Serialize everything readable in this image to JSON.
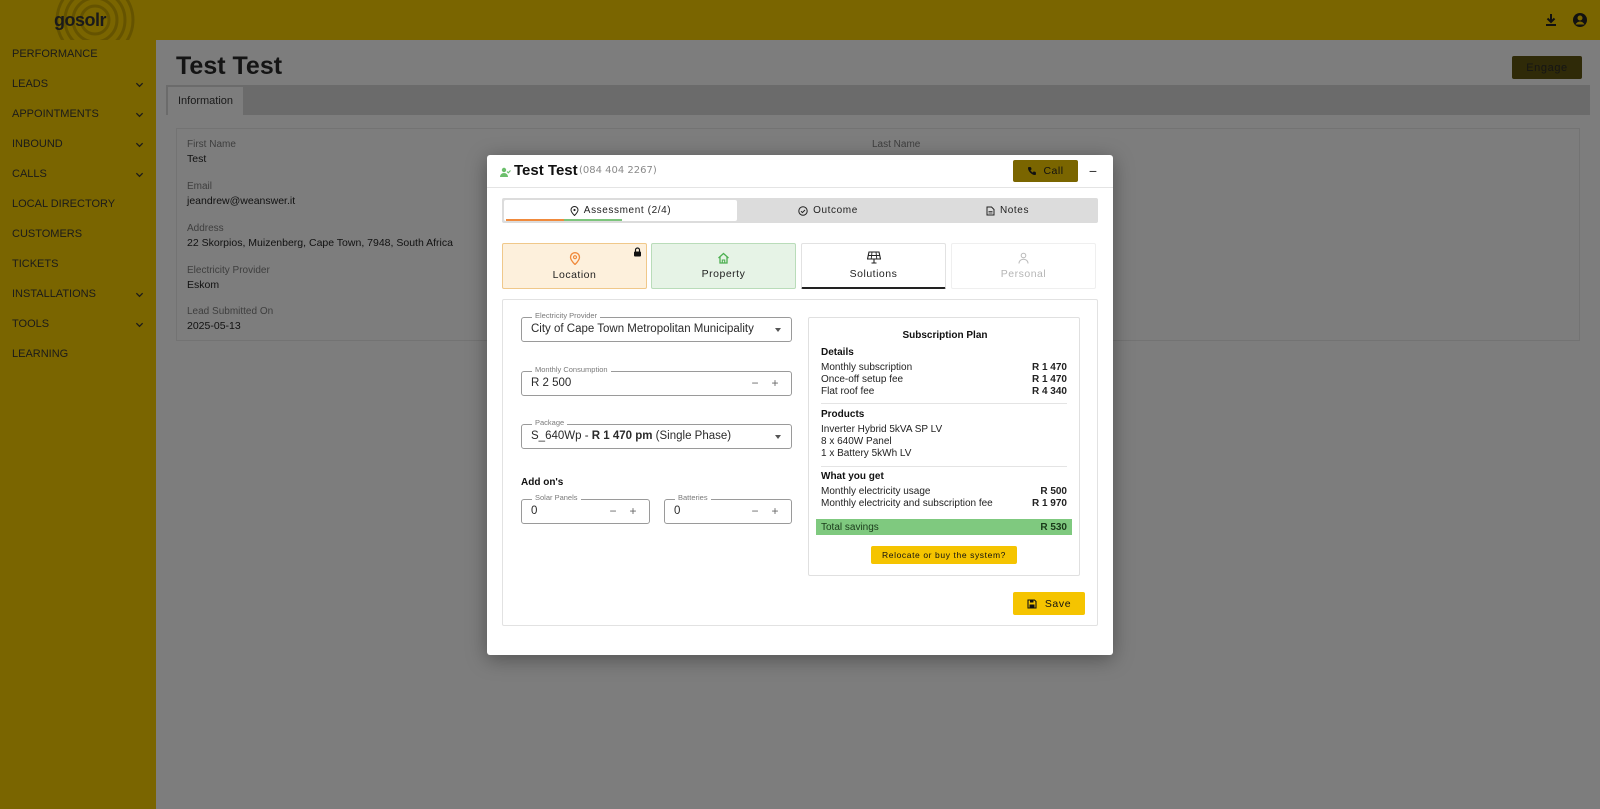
{
  "app": {
    "logo": "gosolr"
  },
  "sidebar": {
    "items": [
      {
        "label": "PERFORMANCE",
        "expandable": false
      },
      {
        "label": "LEADS",
        "expandable": true
      },
      {
        "label": "APPOINTMENTS",
        "expandable": true
      },
      {
        "label": "INBOUND",
        "expandable": true
      },
      {
        "label": "CALLS",
        "expandable": true
      },
      {
        "label": "LOCAL DIRECTORY",
        "expandable": false
      },
      {
        "label": "CUSTOMERS",
        "expandable": false
      },
      {
        "label": "TICKETS",
        "expandable": false
      },
      {
        "label": "INSTALLATIONS",
        "expandable": true
      },
      {
        "label": "TOOLS",
        "expandable": true
      },
      {
        "label": "LEARNING",
        "expandable": false
      }
    ]
  },
  "header": {
    "icons": [
      "download-icon",
      "account-icon"
    ]
  },
  "page": {
    "title": "Test Test",
    "engage_label": "Engage",
    "tab_label": "Information",
    "fields": {
      "first_name_label": "First Name",
      "first_name": "Test",
      "last_name_label": "Last Name",
      "email_label": "Email",
      "email": "jeandrew@weanswer.it",
      "address_label": "Address",
      "address": "22 Skorpios, Muizenberg, Cape Town, 7948, South Africa",
      "provider_label": "Electricity Provider",
      "provider": "Eskom",
      "submitted_label": "Lead Submitted On",
      "submitted": "2025-05-13"
    }
  },
  "modal": {
    "title": "Test Test",
    "phone": "(084 404 2267)",
    "call_label": "Call",
    "minimize_label": "−",
    "tabs": {
      "assessment": "Assessment (2/4)",
      "outcome": "Outcome",
      "notes": "Notes"
    },
    "assessment_progress": 0.5,
    "steps": {
      "location": "Location",
      "property": "Property",
      "solutions": "Solutions",
      "personal": "Personal"
    },
    "form": {
      "provider_legend": "Electricity Provider",
      "provider_value": "City of Cape Town Metropolitan Municipality",
      "consumption_legend": "Monthly Consumption",
      "consumption_value": "R 2 500",
      "package_legend": "Package",
      "package_prefix": "S_640Wp - ",
      "package_price": "R 1 470 pm",
      "package_suffix": " (Single Phase)",
      "addons_title": "Add on's",
      "panels_legend": "Solar Panels",
      "panels_value": "0",
      "batteries_legend": "Batteries",
      "batteries_value": "0",
      "minus": "−",
      "plus": "+"
    },
    "plan": {
      "title": "Subscription Plan",
      "details_heading": "Details",
      "monthly_sub_label": "Monthly subscription",
      "monthly_sub": "R 1 470",
      "setup_label": "Once-off setup fee",
      "setup": "R 1 470",
      "flat_roof_label": "Flat roof fee",
      "flat_roof": "R 4 340",
      "products_heading": "Products",
      "products": [
        "Inverter Hybrid 5kVA SP LV",
        "8 x 640W Panel",
        "1 x Battery 5kWh LV"
      ],
      "get_heading": "What you get",
      "usage_label": "Monthly electricity usage",
      "usage": "R 500",
      "usage_sub_label": "Monthly electricity and subscription fee",
      "usage_sub": "R 1 970",
      "savings_label": "Total savings",
      "savings": "R 530",
      "relocate_label": "Relocate or buy the system?"
    },
    "save_label": "Save"
  },
  "colors": {
    "brand_yellow": "#f5c400",
    "dim_yellow": "#7a6500",
    "location_bg": "#fdf0dc",
    "property_bg": "#e6f3e6",
    "savings_green": "#7fc97f",
    "progress_orange": "#f08a3c",
    "progress_green": "#7cc47c"
  }
}
